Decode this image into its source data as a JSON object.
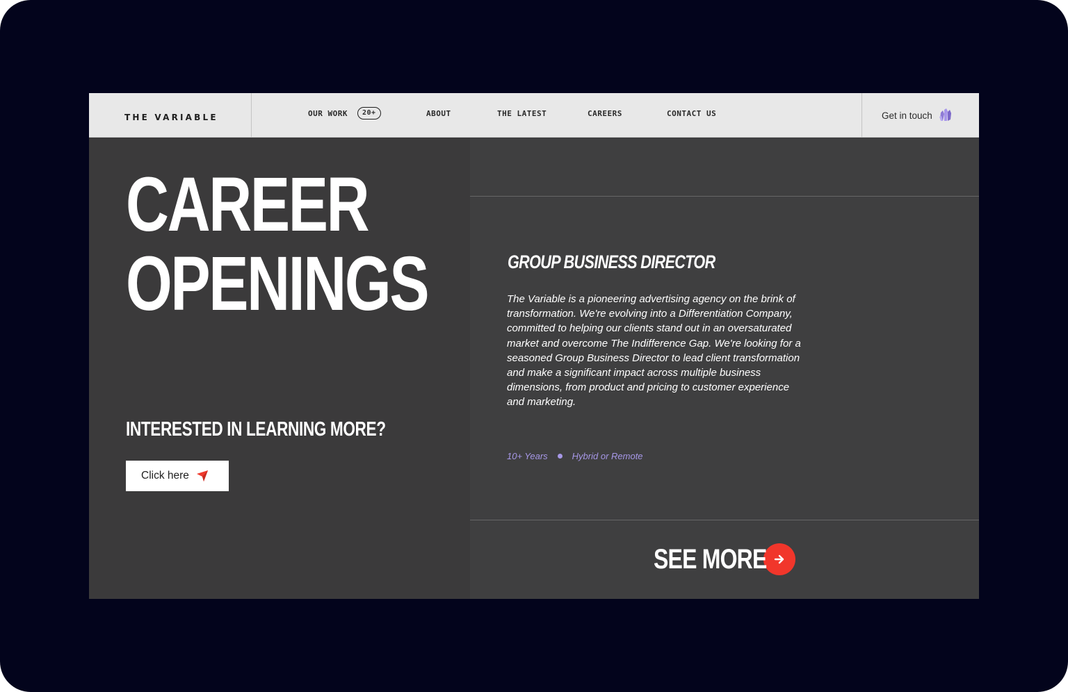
{
  "header": {
    "logo": "THE VARIABLE",
    "nav": [
      {
        "label": "OUR WORK",
        "badge": "20+"
      },
      {
        "label": "ABOUT"
      },
      {
        "label": "THE LATEST"
      },
      {
        "label": "CAREERS"
      },
      {
        "label": "CONTACT US"
      }
    ],
    "cta_label": "Get in touch",
    "cta_icon": "crystal-icon"
  },
  "hero": {
    "line1": "CAREER",
    "line2": "OPENINGS",
    "learn_heading": "INTERESTED IN LEARNING MORE?",
    "click_label": "Click here",
    "click_icon": "paper-plane-icon"
  },
  "job": {
    "title": "GROUP BUSINESS DIRECTOR",
    "description": "The Variable is a pioneering advertising agency on the brink of transformation. We're evolving into a Differentiation Company, committed to helping our clients stand out in an oversaturated market and overcome The Indifference Gap. We're looking for a seasoned Group Business Director to lead client transformation and make a significant impact across multiple business dimensions, from product and pricing to customer experience and marketing.",
    "experience": "10+ Years",
    "location": "Hybrid or Remote"
  },
  "see_more": {
    "label": "SEE MORE",
    "icon": "arrow-right-icon"
  },
  "colors": {
    "page_bg": "#03041c",
    "header_bg": "#e8e8e8",
    "left_bg": "#3b3a3b",
    "right_bg": "#3f3f40",
    "accent_red": "#f1362b",
    "accent_purple": "#a697e6"
  }
}
